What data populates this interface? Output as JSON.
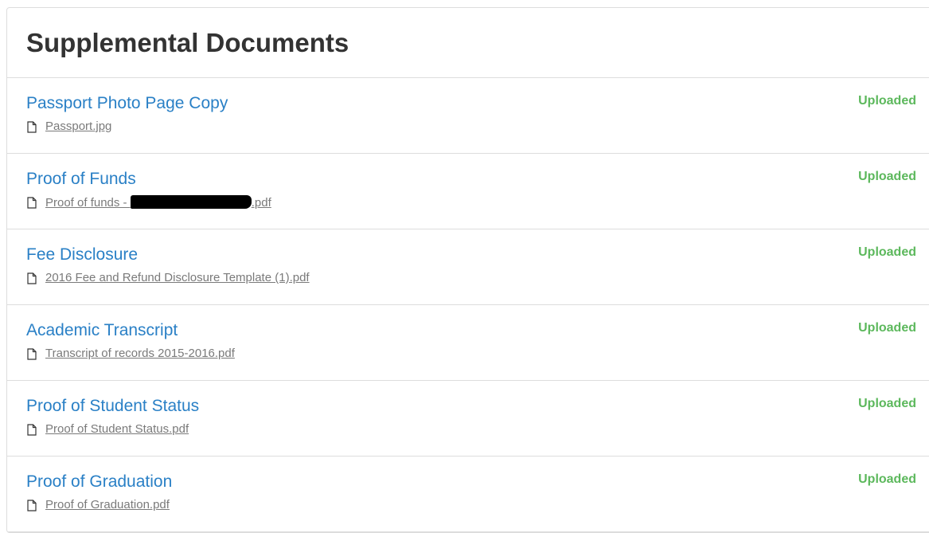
{
  "panel": {
    "title": "Supplemental Documents"
  },
  "documents": [
    {
      "title": "Passport Photo Page Copy",
      "file_prefix": "Passport.jpg",
      "file_suffix": "",
      "redacted": false,
      "status": "Uploaded"
    },
    {
      "title": "Proof of Funds",
      "file_prefix": "Proof of funds - ",
      "file_suffix": ".pdf",
      "redacted": true,
      "status": "Uploaded"
    },
    {
      "title": "Fee Disclosure",
      "file_prefix": "2016 Fee and Refund Disclosure Template (1).pdf",
      "file_suffix": "",
      "redacted": false,
      "status": "Uploaded"
    },
    {
      "title": "Academic Transcript",
      "file_prefix": "Transcript of records 2015-2016.pdf",
      "file_suffix": "",
      "redacted": false,
      "status": "Uploaded"
    },
    {
      "title": "Proof of Student Status",
      "file_prefix": "Proof of Student Status.pdf",
      "file_suffix": "",
      "redacted": false,
      "status": "Uploaded"
    },
    {
      "title": "Proof of Graduation",
      "file_prefix": "Proof of Graduation.pdf",
      "file_suffix": "",
      "redacted": false,
      "status": "Uploaded"
    }
  ],
  "icons": {
    "file": "file-icon"
  },
  "colors": {
    "title_link": "#2a80c6",
    "status_uploaded": "#5cb85c",
    "file_link": "#7a7a7a",
    "heading": "#333333",
    "border": "#dddddd"
  }
}
